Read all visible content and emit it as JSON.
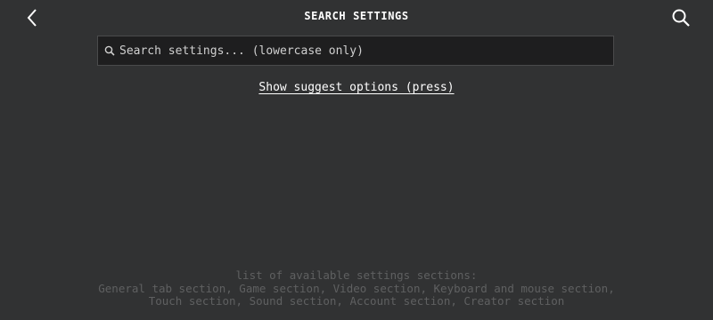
{
  "header": {
    "title": "SEARCH SETTINGS",
    "back_icon": "chevron-left-icon",
    "search_icon": "search-icon"
  },
  "search": {
    "placeholder": "Search settings... (lowercase only)",
    "value": "",
    "icon": "search-icon"
  },
  "suggest_link": "Show suggest options (press)",
  "footer": {
    "lines": [
      "list of available settings sections:",
      "General tab section, Game section, Video section, Keyboard and mouse section,",
      "Touch section, Sound section, Account section, Creator section"
    ]
  },
  "colors": {
    "background": "#313233",
    "input_background": "#1e1e1f",
    "footer_text": "#5f6061",
    "text": "#ffffff"
  }
}
